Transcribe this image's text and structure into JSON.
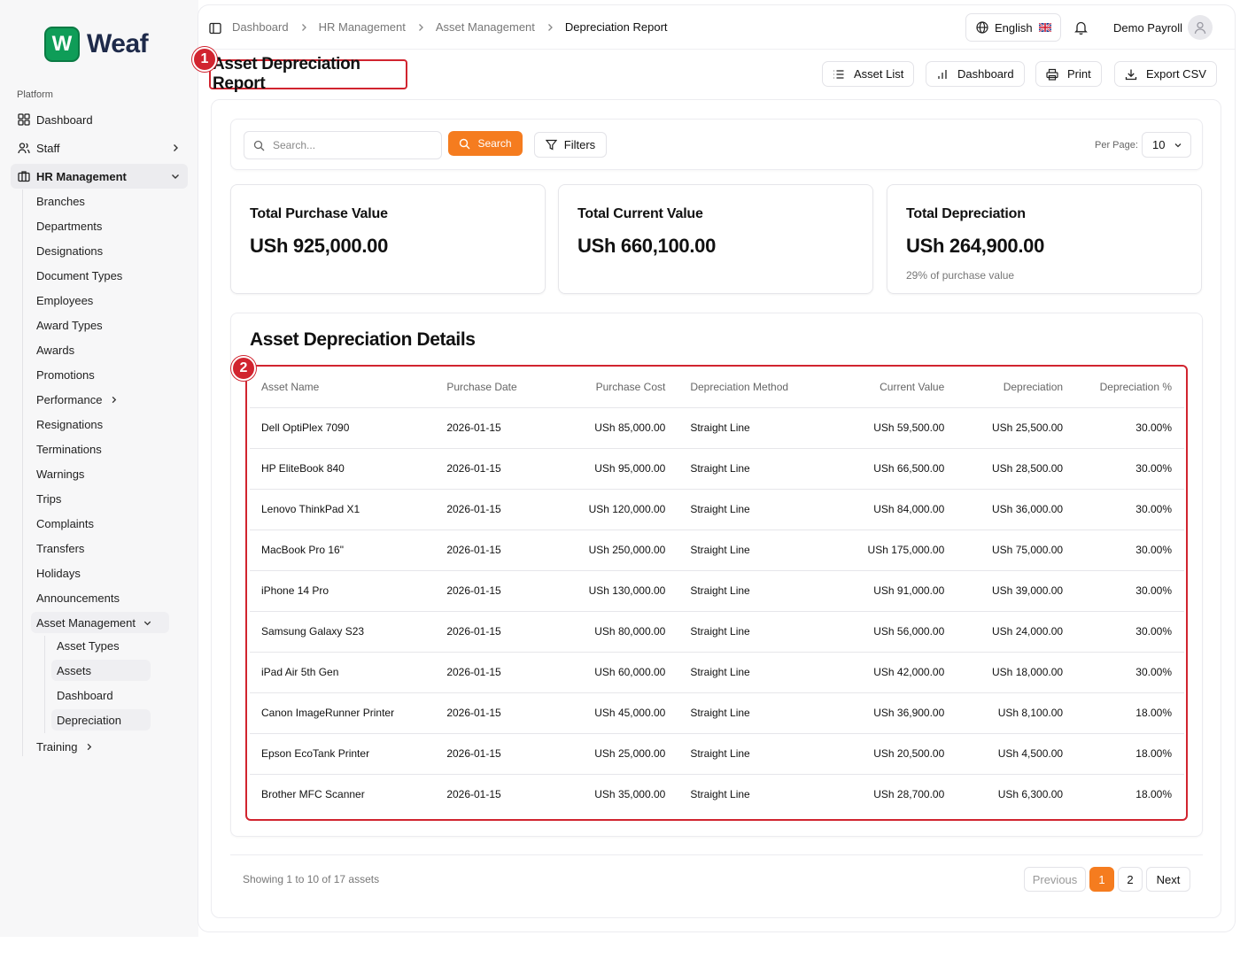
{
  "brand": {
    "badge": "W",
    "name": "Weaf",
    "color": "#0f9d58"
  },
  "sidebar": {
    "section_label": "Platform",
    "items": [
      {
        "label": "Dashboard",
        "icon": "grid-icon"
      },
      {
        "label": "Staff",
        "icon": "users-icon"
      },
      {
        "label": "HR Management",
        "icon": "briefcase-icon"
      }
    ],
    "hr_sub": [
      "Branches",
      "Departments",
      "Designations",
      "Document Types",
      "Employees",
      "Award Types",
      "Awards",
      "Promotions",
      "Performance",
      "Resignations",
      "Terminations",
      "Warnings",
      "Trips",
      "Complaints",
      "Transfers",
      "Holidays",
      "Announcements",
      "Asset Management",
      "Training"
    ],
    "asset_sub": [
      "Asset Types",
      "Assets",
      "Dashboard",
      "Depreciation"
    ]
  },
  "header": {
    "breadcrumb": [
      "Dashboard",
      "HR Management",
      "Asset Management",
      "Depreciation Report"
    ],
    "language": "English",
    "user": "Demo Payroll"
  },
  "page": {
    "title": "Asset Depreciation Report",
    "markers": [
      "1",
      "2"
    ],
    "actions": [
      "Asset List",
      "Dashboard",
      "Print",
      "Export CSV"
    ]
  },
  "search": {
    "placeholder": "Search...",
    "button": "Search",
    "filters": "Filters",
    "per_page_label": "Per Page:",
    "per_page_value": "10"
  },
  "stats": [
    {
      "label": "Total Purchase Value",
      "value": "USh 925,000.00",
      "sub": ""
    },
    {
      "label": "Total Current Value",
      "value": "USh 660,100.00",
      "sub": ""
    },
    {
      "label": "Total Depreciation",
      "value": "USh 264,900.00",
      "sub": "29% of purchase value"
    }
  ],
  "details": {
    "title": "Asset Depreciation Details",
    "columns": [
      "Asset Name",
      "Purchase Date",
      "Purchase Cost",
      "Depreciation Method",
      "Current Value",
      "Depreciation",
      "Depreciation %"
    ],
    "rows": [
      [
        "Dell OptiPlex 7090",
        "2026-01-15",
        "USh 85,000.00",
        "Straight Line",
        "USh 59,500.00",
        "USh 25,500.00",
        "30.00%"
      ],
      [
        "HP EliteBook 840",
        "2026-01-15",
        "USh 95,000.00",
        "Straight Line",
        "USh 66,500.00",
        "USh 28,500.00",
        "30.00%"
      ],
      [
        "Lenovo ThinkPad X1",
        "2026-01-15",
        "USh 120,000.00",
        "Straight Line",
        "USh 84,000.00",
        "USh 36,000.00",
        "30.00%"
      ],
      [
        "MacBook Pro 16\"",
        "2026-01-15",
        "USh 250,000.00",
        "Straight Line",
        "USh 175,000.00",
        "USh 75,000.00",
        "30.00%"
      ],
      [
        "iPhone 14 Pro",
        "2026-01-15",
        "USh 130,000.00",
        "Straight Line",
        "USh 91,000.00",
        "USh 39,000.00",
        "30.00%"
      ],
      [
        "Samsung Galaxy S23",
        "2026-01-15",
        "USh 80,000.00",
        "Straight Line",
        "USh 56,000.00",
        "USh 24,000.00",
        "30.00%"
      ],
      [
        "iPad Air 5th Gen",
        "2026-01-15",
        "USh 60,000.00",
        "Straight Line",
        "USh 42,000.00",
        "USh 18,000.00",
        "30.00%"
      ],
      [
        "Canon ImageRunner Printer",
        "2026-01-15",
        "USh 45,000.00",
        "Straight Line",
        "USh 36,900.00",
        "USh 8,100.00",
        "18.00%"
      ],
      [
        "Epson EcoTank Printer",
        "2026-01-15",
        "USh 25,000.00",
        "Straight Line",
        "USh 20,500.00",
        "USh 4,500.00",
        "18.00%"
      ],
      [
        "Brother MFC Scanner",
        "2026-01-15",
        "USh 35,000.00",
        "Straight Line",
        "USh 28,700.00",
        "USh 6,300.00",
        "18.00%"
      ]
    ]
  },
  "pagination": {
    "showing": "Showing 1 to 10 of 17 assets",
    "previous": "Previous",
    "pages": [
      "1",
      "2"
    ],
    "next": "Next"
  },
  "colors": {
    "accent": "#f57c1f",
    "highlight": "#d1242f"
  }
}
